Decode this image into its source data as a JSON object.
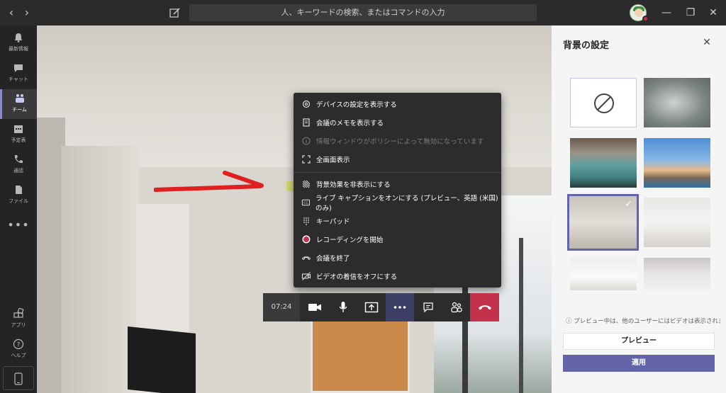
{
  "titlebar": {
    "search_placeholder": "人、キーワードの検索、またはコマンドの入力",
    "back_icon": "chevron-left-icon",
    "forward_icon": "chevron-right-icon"
  },
  "rail": {
    "items": [
      {
        "label": "最新情報",
        "icon": "bell-icon"
      },
      {
        "label": "チャット",
        "icon": "chat-icon"
      },
      {
        "label": "チーム",
        "icon": "teams-icon"
      },
      {
        "label": "予定表",
        "icon": "calendar-icon"
      },
      {
        "label": "通話",
        "icon": "phone-icon"
      },
      {
        "label": "ファイル",
        "icon": "file-icon"
      },
      {
        "label": "アプリ",
        "icon": "apps-icon"
      },
      {
        "label": "ヘルプ",
        "icon": "help-icon"
      }
    ],
    "more": "•••"
  },
  "menu": {
    "items": [
      {
        "label": "デバイスの設定を表示する",
        "icon": "gear-icon",
        "disabled": false
      },
      {
        "label": "会議のメモを表示する",
        "icon": "notes-icon",
        "disabled": false
      },
      {
        "label": "情報ウィンドウがポリシーによって無効になっています",
        "icon": "info-icon",
        "disabled": true
      },
      {
        "label": "全画面表示",
        "icon": "fullscreen-icon",
        "disabled": false
      },
      {
        "label": "背景効果を非表示にする",
        "icon": "background-effects-icon",
        "disabled": false
      },
      {
        "label": "ライブ キャプションをオンにする (プレビュー、英語 (米国) のみ)",
        "icon": "cc-icon",
        "disabled": false
      },
      {
        "label": "キーパッド",
        "icon": "keypad-icon",
        "disabled": false
      },
      {
        "label": "レコーディングを開始",
        "icon": "record-icon",
        "disabled": false
      },
      {
        "label": "会議を終了",
        "icon": "end-meeting-icon",
        "disabled": false
      },
      {
        "label": "ビデオの着信をオフにする",
        "icon": "video-off-icon",
        "disabled": false
      }
    ]
  },
  "callbar": {
    "time": "07:24",
    "hangup_color": "#c4314b",
    "more_color": "#3d3e66"
  },
  "panel": {
    "title": "背景の設定",
    "info": "プレビュー中は、他のユーザーにはビデオは表示されま…",
    "preview_label": "プレビュー",
    "apply_label": "適用",
    "accent": "#6264a7"
  }
}
